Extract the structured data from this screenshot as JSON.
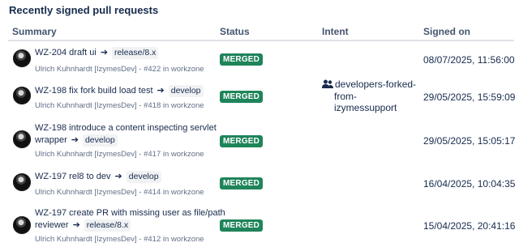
{
  "section_title": "Recently signed pull requests",
  "columns": {
    "summary": "Summary",
    "status": "Status",
    "intent": "Intent",
    "signed_on": "Signed on"
  },
  "rows": [
    {
      "title": "WZ-204 draft ui",
      "title2": "",
      "branch": "release/8.x",
      "meta": "Ulrich Kuhnhardt [IzymesDev] - #422 in workzone",
      "status": "MERGED",
      "intent": null,
      "signed_on": "08/07/2025, 11:56:00"
    },
    {
      "title": "WZ-198 fix fork build load test",
      "title2": "",
      "branch": "develop",
      "meta": "Ulrich Kuhnhardt [IzymesDev] - #418 in workzone",
      "status": "MERGED",
      "intent": {
        "icon": "group-icon",
        "lines": [
          "developers-forked-",
          "from-",
          "izymessupport"
        ]
      },
      "signed_on": "29/05/2025, 15:59:09"
    },
    {
      "title": "WZ-198 introduce a content inspecting servlet",
      "title2": "wrapper",
      "branch": "develop",
      "meta": "Ulrich Kuhnhardt [IzymesDev] - #417 in workzone",
      "status": "MERGED",
      "intent": null,
      "signed_on": "29/05/2025, 15:05:17"
    },
    {
      "title": "WZ-197 rel8 to dev",
      "title2": "",
      "branch": "develop",
      "meta": "Ulrich Kuhnhardt [IzymesDev] - #414 in workzone",
      "status": "MERGED",
      "intent": null,
      "signed_on": "16/04/2025, 10:04:35"
    },
    {
      "title": "WZ-197 create PR with missing user as file/path",
      "title2": "reviewer",
      "branch": "release/8.x",
      "meta": "Ulrich Kuhnhardt [IzymesDev] - #412 in workzone",
      "status": "MERGED",
      "intent": null,
      "signed_on": "15/04/2025, 20:41:16"
    }
  ]
}
